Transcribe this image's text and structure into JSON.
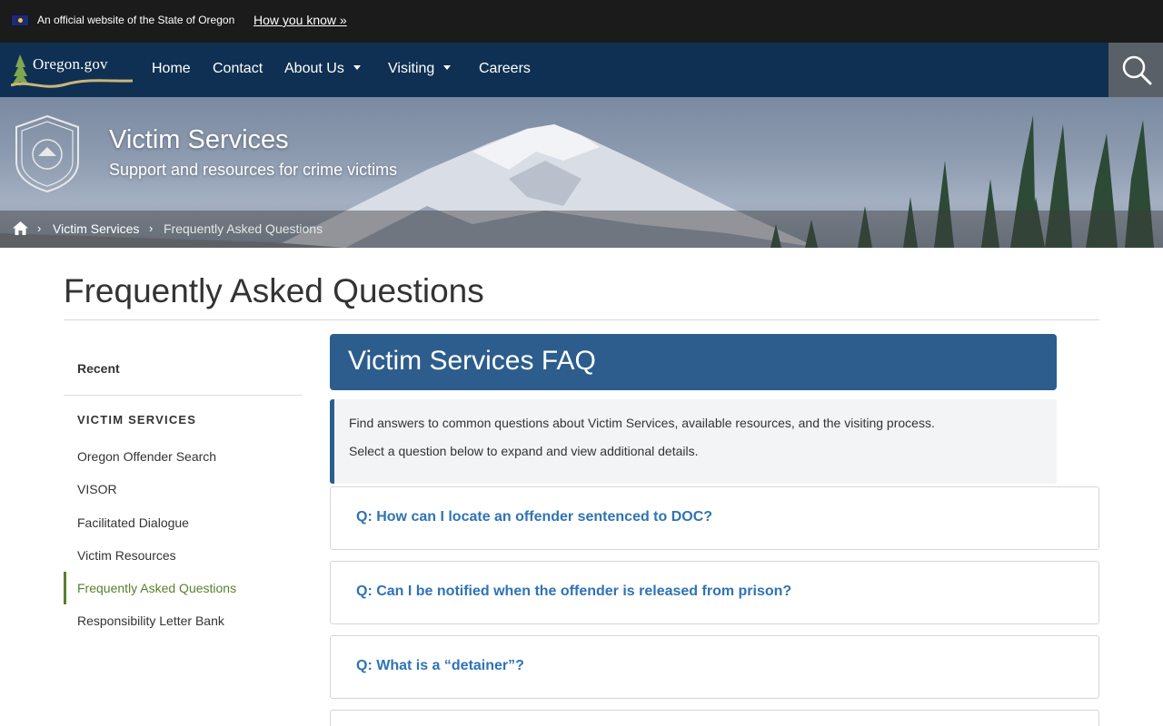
{
  "gov_banner": {
    "official_text": "An official website of the State of Oregon",
    "how_you_know": "How you know »"
  },
  "nav": {
    "logo_text": "Oregon.gov",
    "items": [
      {
        "label": "Home",
        "has_caret": false
      },
      {
        "label": "Contact",
        "has_caret": false
      },
      {
        "label": "About Us",
        "has_caret": true
      },
      {
        "label": "Visiting",
        "has_caret": true
      },
      {
        "label": "Careers",
        "has_caret": false
      }
    ],
    "search_icon": "search-icon"
  },
  "hero": {
    "title": "Victim Services",
    "subtitle": "Support and resources for crime victims",
    "seal_icon": "oregon-doc-seal"
  },
  "breadcrumb": {
    "home_icon": "home-icon",
    "items": [
      "Victim Services",
      "Frequently Asked Questions"
    ]
  },
  "page": {
    "title": "Frequently Asked Questions"
  },
  "sidebar": {
    "recent": "Recent",
    "heading": "VICTIM SERVICES",
    "items": [
      {
        "label": "Oregon Offender Search",
        "active": false
      },
      {
        "label": "VISOR",
        "active": false
      },
      {
        "label": "Facilitated Dialogue",
        "active": false
      },
      {
        "label": "Victim Resources",
        "active": false
      },
      {
        "label": "Frequently Asked Questions",
        "active": true
      },
      {
        "label": "Responsibility Letter Bank",
        "active": false
      }
    ]
  },
  "main": {
    "faq_header": "Victim Services FAQ",
    "intro": [
      "Find answers to common questions about Victim Services, available resources, and the visiting process.",
      "Select a question below to expand and view additional details."
    ],
    "questions": [
      "Q: How can I locate an offender sentenced to DOC?",
      "Q: Can I be notified when the offender is released from prison?",
      "Q: What is a “detainer”?"
    ]
  },
  "colors": {
    "banner": "#1b1b1b",
    "nav": "#0f3052",
    "accent_blue": "#2c5d8d",
    "link_blue": "#2f73b5",
    "active_green": "#5a7f2e"
  }
}
